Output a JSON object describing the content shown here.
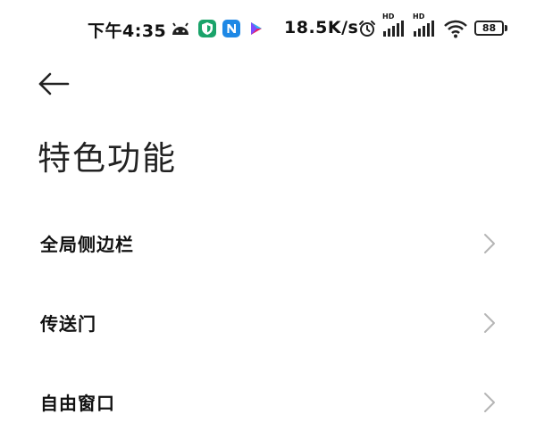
{
  "status_bar": {
    "time": "下午4:35",
    "net_speed": "18.5K/s",
    "hd1": "HD",
    "hd2": "HD",
    "battery": "88",
    "icons": [
      "android-debug-icon",
      "vpn-shield-icon",
      "n-app-icon",
      "play-store-icon",
      "alarm-icon",
      "signal-1-icon",
      "signal-2-icon",
      "wifi-icon",
      "battery-icon"
    ]
  },
  "header": {
    "back_icon": "arrow-left-icon",
    "title": "特色功能"
  },
  "list": {
    "items": [
      {
        "label": "全局侧边栏"
      },
      {
        "label": "传送门"
      },
      {
        "label": "自由窗口"
      }
    ]
  },
  "colors": {
    "background": "#ffffff",
    "text": "#111111",
    "chevron": "#b5b5b5",
    "vpn_icon": "#1aa36a",
    "n_icon": "#1e88e5"
  }
}
